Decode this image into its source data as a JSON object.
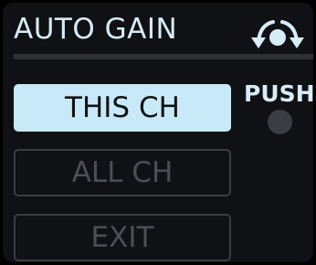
{
  "header": {
    "title": "AUTO GAIN",
    "encoder_icon": "rotate-encoder-icon"
  },
  "buttons": {
    "this_ch": "THIS CH",
    "all_ch": "ALL CH",
    "exit": "EXIT"
  },
  "push": {
    "label": "PUSH",
    "icon": "push-button-icon"
  },
  "colors": {
    "accent_text": "#d6ecf6",
    "selected_button_bg": "#c8eaf8",
    "inactive_text": "#4b4e53",
    "background": "#101114"
  }
}
